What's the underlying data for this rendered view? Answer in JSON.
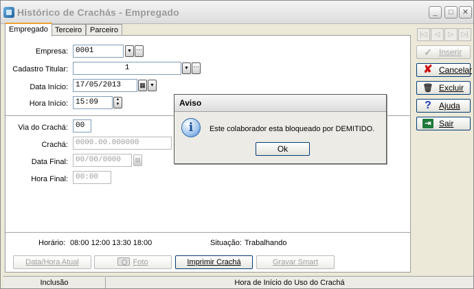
{
  "window": {
    "title": "Histórico de Crachás - Empregado",
    "controls": {
      "minimize": "_",
      "maximize": "□",
      "close": "✕"
    }
  },
  "tabs": [
    {
      "label": "Empregado",
      "active": true
    },
    {
      "label": "Terceiro",
      "active": false
    },
    {
      "label": "Parceiro",
      "active": false
    }
  ],
  "form": {
    "empresa": {
      "label": "Empresa:",
      "value": "0001"
    },
    "cadastro_titular": {
      "label": "Cadastro Titular:",
      "value": "1"
    },
    "data_inicio": {
      "label": "Data Início:",
      "value": "17/05/2013"
    },
    "hora_inicio": {
      "label": "Hora Início:",
      "value": "15:09"
    },
    "via_cracha": {
      "label": "Via do Crachá:",
      "value": "00"
    },
    "cracha": {
      "label": "Crachá:",
      "value": "0000.00.000000"
    },
    "data_final": {
      "label": "Data Final:",
      "value": "00/00/0000"
    },
    "hora_final": {
      "label": "Hora Final:",
      "value": "00:00"
    }
  },
  "info": {
    "horario_label": "Horário:",
    "horario_value": "08:00 12:00 13:30 18:00",
    "situacao_label": "Situação:",
    "situacao_value": "Trabalhando"
  },
  "bottom_buttons": {
    "data_hora_atual": "Data/Hora Atual",
    "foto": "Foto",
    "imprimir_cracha": "Imprimir Crachá",
    "gravar_smart": "Gravar Smart"
  },
  "nav_buttons": [
    "|◁",
    "◁",
    "▷",
    "▷|"
  ],
  "actions": {
    "inserir": "Inserir",
    "cancelar": "Cancelar",
    "excluir": "Excluir",
    "ajuda": "Ajuda",
    "sair": "Sair"
  },
  "dialog": {
    "title": "Aviso",
    "message": "Este colaborador esta bloqueado por DEMITIDO.",
    "ok_label": "Ok",
    "icon_glyph": "i"
  },
  "statusbar": {
    "mode": "Inclusão",
    "hint": "Hora de Início do Uso do Crachá"
  },
  "colors": {
    "cancel_icon": "#cc1010",
    "help_icon": "#1a3fb0",
    "tab_active_accent": "#f0a030"
  }
}
